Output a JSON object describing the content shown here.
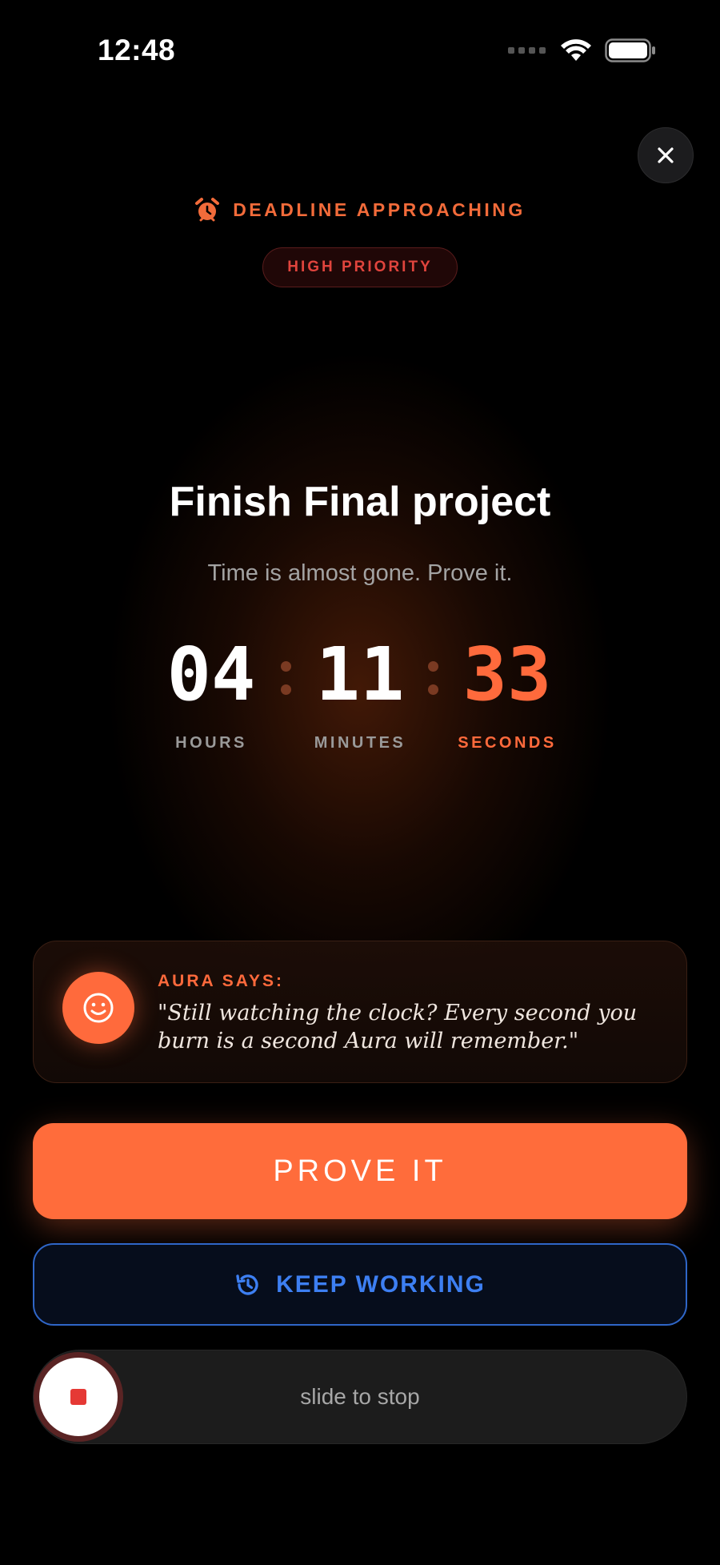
{
  "status_bar": {
    "time": "12:48"
  },
  "header": {
    "alert_icon": "alarm-clock-icon",
    "alert_text": "DEADLINE APPROACHING",
    "priority_badge": "HIGH PRIORITY",
    "close_icon": "close-icon"
  },
  "task": {
    "title": "Finish Final project",
    "subtitle": "Time is almost gone. Prove it."
  },
  "countdown": {
    "hours": "04",
    "hours_label": "HOURS",
    "minutes": "11",
    "minutes_label": "MINUTES",
    "seconds": "33",
    "seconds_label": "SECONDS"
  },
  "aura": {
    "label": "AURA SAYS:",
    "quote": "\"Still watching the clock? Every second you burn is a second Aura will remember.\"",
    "avatar_icon": "smiley-face-icon"
  },
  "actions": {
    "prove_label": "PROVE IT",
    "keep_label": "KEEP WORKING",
    "keep_icon": "history-icon",
    "slider_label": "slide to stop",
    "slider_icon": "stop-icon"
  },
  "colors": {
    "accent": "#ff6c3b",
    "priority_red": "#e0443d",
    "keep_blue": "#3d7ff2",
    "background": "#000000"
  }
}
